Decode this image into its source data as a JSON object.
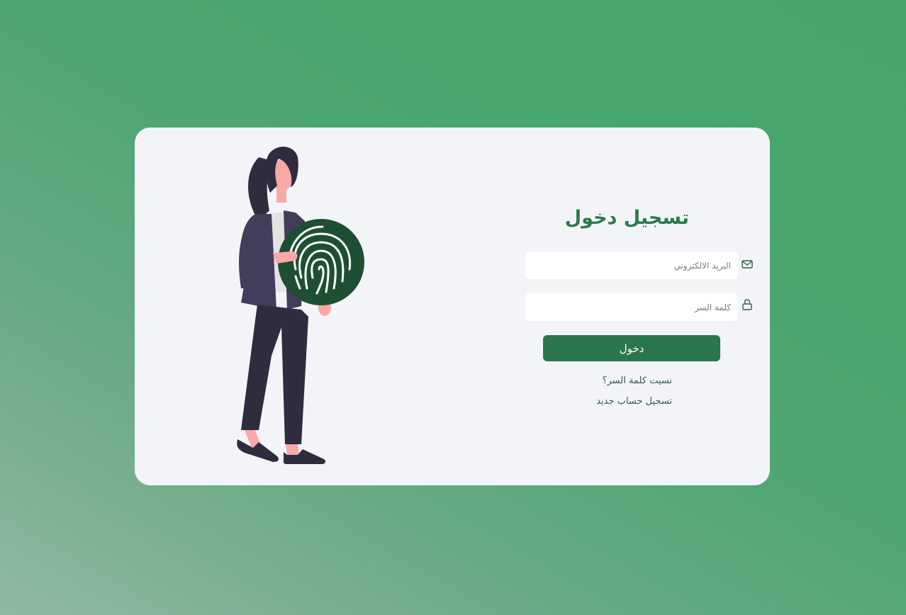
{
  "login": {
    "title": "تسجيل دخول",
    "email": {
      "placeholder": "البريد الالكتروني",
      "value": "",
      "icon": "envelope-icon"
    },
    "password": {
      "placeholder": "كلمة السر",
      "value": "",
      "icon": "lock-icon"
    },
    "submit_label": "دخول",
    "forgot_password_label": "نسيت كلمة السر؟",
    "register_label": "تسجيل حساب جديد"
  },
  "illustration": {
    "icon": "fingerprint-icon"
  },
  "colors": {
    "background_gradient_start": "#8fb9a2",
    "background_gradient_end": "#45a56c",
    "card": "#f3f4f8",
    "title": "#2b7a4d",
    "button": "#2b774b",
    "fingerprint_circle": "#1f4f33"
  }
}
